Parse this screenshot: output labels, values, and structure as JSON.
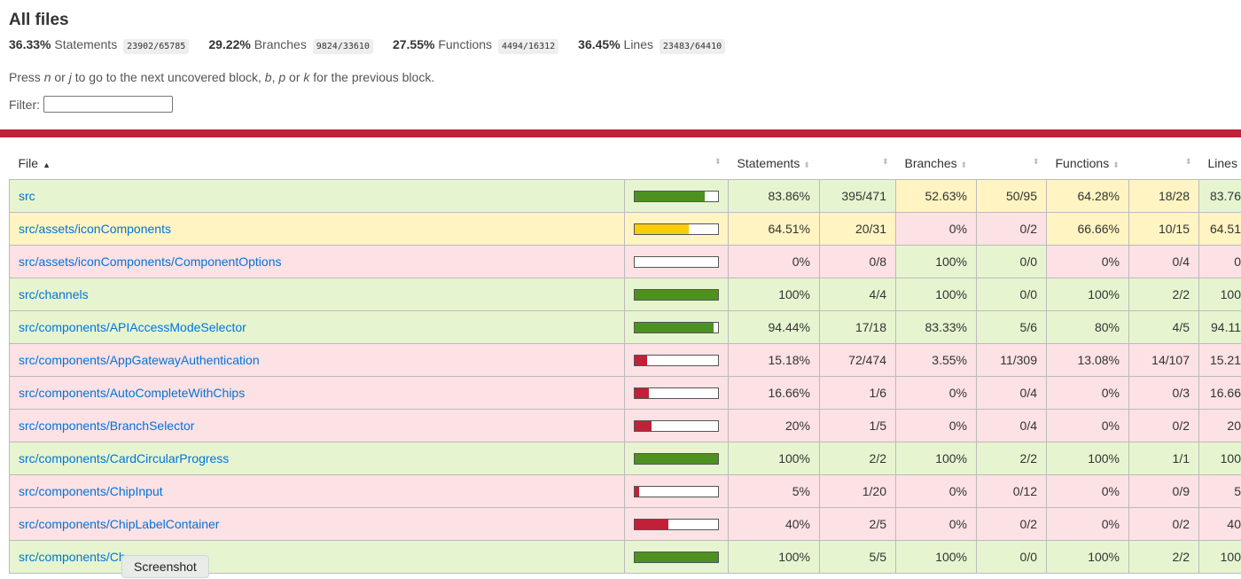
{
  "title": "All files",
  "summary": [
    {
      "pct": "36.33%",
      "label": "Statements",
      "fraction": "23902/65785"
    },
    {
      "pct": "29.22%",
      "label": "Branches",
      "fraction": "9824/33610"
    },
    {
      "pct": "27.55%",
      "label": "Functions",
      "fraction": "4494/16312"
    },
    {
      "pct": "36.45%",
      "label": "Lines",
      "fraction": "23483/64410"
    }
  ],
  "hint": {
    "p1": "Press ",
    "n": "n",
    "p2": " or ",
    "j": "j",
    "p3": " to go to the next uncovered block, ",
    "b": "b",
    "p4": ", ",
    "p": "p",
    "p5": " or ",
    "k": "k",
    "p6": " for the previous block."
  },
  "filter": {
    "label": "Filter:",
    "value": ""
  },
  "columns": {
    "file": "File",
    "statements": "Statements",
    "branches": "Branches",
    "functions": "Functions",
    "lines": "Lines"
  },
  "colors": {
    "high": "#e6f5d0",
    "medium": "#fff4c2",
    "low": "#fce1e5",
    "bar_high": "#4d9221",
    "bar_medium": "#f9cd0b",
    "bar_low": "#c21f39",
    "link": "#0074d9"
  },
  "rows": [
    {
      "file": "src",
      "level": "high",
      "coverage": 0.8386,
      "stmt_pct": "83.86%",
      "stmt_frac": "395/471",
      "stmt_lvl": "high",
      "br_pct": "52.63%",
      "br_frac": "50/95",
      "br_lvl": "medium",
      "fn_pct": "64.28%",
      "fn_frac": "18/28",
      "fn_lvl": "medium",
      "ln_pct": "83.76",
      "ln_lvl": "high"
    },
    {
      "file": "src/assets/iconComponents",
      "level": "medium",
      "coverage": 0.6451,
      "stmt_pct": "64.51%",
      "stmt_frac": "20/31",
      "stmt_lvl": "medium",
      "br_pct": "0%",
      "br_frac": "0/2",
      "br_lvl": "low",
      "fn_pct": "66.66%",
      "fn_frac": "10/15",
      "fn_lvl": "medium",
      "ln_pct": "64.51",
      "ln_lvl": "medium"
    },
    {
      "file": "src/assets/iconComponents/ComponentOptions",
      "level": "low",
      "coverage": 0,
      "stmt_pct": "0%",
      "stmt_frac": "0/8",
      "stmt_lvl": "low",
      "br_pct": "100%",
      "br_frac": "0/0",
      "br_lvl": "high",
      "fn_pct": "0%",
      "fn_frac": "0/4",
      "fn_lvl": "low",
      "ln_pct": "0",
      "ln_lvl": "low"
    },
    {
      "file": "src/channels",
      "level": "high",
      "coverage": 1,
      "stmt_pct": "100%",
      "stmt_frac": "4/4",
      "stmt_lvl": "high",
      "br_pct": "100%",
      "br_frac": "0/0",
      "br_lvl": "high",
      "fn_pct": "100%",
      "fn_frac": "2/2",
      "fn_lvl": "high",
      "ln_pct": "100",
      "ln_lvl": "high"
    },
    {
      "file": "src/components/APIAccessModeSelector",
      "level": "high",
      "coverage": 0.9444,
      "stmt_pct": "94.44%",
      "stmt_frac": "17/18",
      "stmt_lvl": "high",
      "br_pct": "83.33%",
      "br_frac": "5/6",
      "br_lvl": "high",
      "fn_pct": "80%",
      "fn_frac": "4/5",
      "fn_lvl": "high",
      "ln_pct": "94.11",
      "ln_lvl": "high"
    },
    {
      "file": "src/components/AppGatewayAuthentication",
      "level": "low",
      "coverage": 0.1518,
      "stmt_pct": "15.18%",
      "stmt_frac": "72/474",
      "stmt_lvl": "low",
      "br_pct": "3.55%",
      "br_frac": "11/309",
      "br_lvl": "low",
      "fn_pct": "13.08%",
      "fn_frac": "14/107",
      "fn_lvl": "low",
      "ln_pct": "15.21",
      "ln_lvl": "low"
    },
    {
      "file": "src/components/AutoCompleteWithChips",
      "level": "low",
      "coverage": 0.1666,
      "stmt_pct": "16.66%",
      "stmt_frac": "1/6",
      "stmt_lvl": "low",
      "br_pct": "0%",
      "br_frac": "0/4",
      "br_lvl": "low",
      "fn_pct": "0%",
      "fn_frac": "0/3",
      "fn_lvl": "low",
      "ln_pct": "16.66",
      "ln_lvl": "low"
    },
    {
      "file": "src/components/BranchSelector",
      "level": "low",
      "coverage": 0.2,
      "stmt_pct": "20%",
      "stmt_frac": "1/5",
      "stmt_lvl": "low",
      "br_pct": "0%",
      "br_frac": "0/4",
      "br_lvl": "low",
      "fn_pct": "0%",
      "fn_frac": "0/2",
      "fn_lvl": "low",
      "ln_pct": "20",
      "ln_lvl": "low"
    },
    {
      "file": "src/components/CardCircularProgress",
      "level": "high",
      "coverage": 1,
      "stmt_pct": "100%",
      "stmt_frac": "2/2",
      "stmt_lvl": "high",
      "br_pct": "100%",
      "br_frac": "2/2",
      "br_lvl": "high",
      "fn_pct": "100%",
      "fn_frac": "1/1",
      "fn_lvl": "high",
      "ln_pct": "100",
      "ln_lvl": "high"
    },
    {
      "file": "src/components/ChipInput",
      "level": "low",
      "coverage": 0.05,
      "stmt_pct": "5%",
      "stmt_frac": "1/20",
      "stmt_lvl": "low",
      "br_pct": "0%",
      "br_frac": "0/12",
      "br_lvl": "low",
      "fn_pct": "0%",
      "fn_frac": "0/9",
      "fn_lvl": "low",
      "ln_pct": "5",
      "ln_lvl": "low"
    },
    {
      "file": "src/components/ChipLabelContainer",
      "level": "low",
      "coverage": 0.4,
      "stmt_pct": "40%",
      "stmt_frac": "2/5",
      "stmt_lvl": "low",
      "br_pct": "0%",
      "br_frac": "0/2",
      "br_lvl": "low",
      "fn_pct": "0%",
      "fn_frac": "0/2",
      "fn_lvl": "low",
      "ln_pct": "40",
      "ln_lvl": "low"
    },
    {
      "file": "src/components/Ch",
      "level": "high",
      "coverage": 1,
      "stmt_pct": "100%",
      "stmt_frac": "5/5",
      "stmt_lvl": "high",
      "br_pct": "100%",
      "br_frac": "0/0",
      "br_lvl": "high",
      "fn_pct": "100%",
      "fn_frac": "2/2",
      "fn_lvl": "high",
      "ln_pct": "100",
      "ln_lvl": "high"
    }
  ],
  "tooltip": "Screenshot"
}
